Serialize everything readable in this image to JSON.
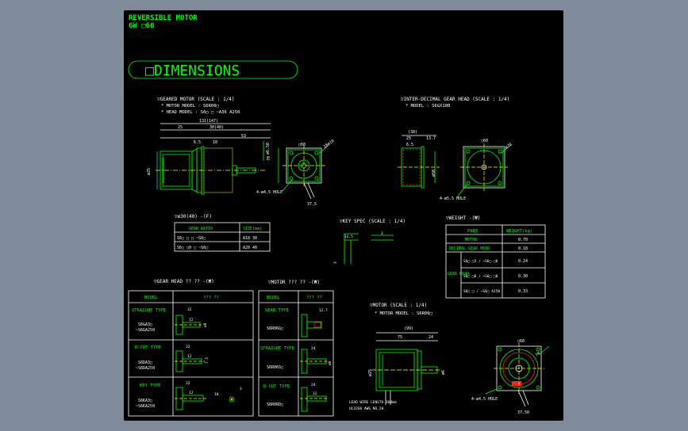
{
  "header": {
    "title": "REVERSIBLE MOTOR",
    "subtitle": "6W  □60"
  },
  "dimensions_title": "□DIMENSIONS",
  "geared_motor": {
    "title": "▽GEARED MOTOR (SCALE : 1/4)",
    "motor_model": "* MOTOR MODEL : S6R06□",
    "head_model": "* HEAD MODEL : S6□ □ ~A36   A250",
    "dims": [
      "131(147)",
      "25",
      "30(40)",
      "53",
      "6.5",
      "10",
      "□60",
      "70",
      "ø25",
      "4-ø4.5 HOLE",
      "28ø10",
      "ø6.50",
      "ø60",
      "37.5"
    ]
  },
  "inter_decimal": {
    "title": "▽INTER-DECIMAL GEAR HEAD (SCALE : 1/4)",
    "model": "* MODEL : S6GX10B",
    "dims": [
      "(38)",
      "25",
      "13.7",
      "□60",
      "6.5",
      "4-ø5.5 HOLE",
      "ø50",
      "ø70"
    ]
  },
  "gear_table": {
    "title": "▽ø30(40) -(₣)",
    "headers": [
      "GEAR RATIO",
      "SIZE(mm)"
    ],
    "rows": [
      [
        "S6□ □ □ ~S6□",
        "A18  30"
      ],
      [
        "S6□ □0 □ ~S6□",
        "A20  40"
      ]
    ]
  },
  "key_spec": {
    "title": "▽KEY SPEC (SCALE : 1/4)",
    "dims": [
      "12.5",
      "3",
      "3"
    ]
  },
  "weight": {
    "title": "▽WEIGHT -(₩)",
    "headers": [
      "PART",
      "WEIGHT(kg)"
    ],
    "rows": [
      {
        "part": "MOTOR",
        "weight": "0.70"
      },
      {
        "part": "DECIMAL GEAR HEAD",
        "weight": "0.18"
      },
      {
        "part": "S6□ □3 / ~S6□ □8",
        "weight": "0.24"
      },
      {
        "part": "S6□ □0 / ~S6□ □0",
        "weight": "0.30"
      },
      {
        "part": "S6□ □ / ~S6□ A250",
        "weight": "0.33"
      }
    ],
    "gear_head_label": "GEAR HEAD"
  },
  "gear_head_table": {
    "title": "▽GEAR HEAD ??  ??   -(₩)",
    "headers": [
      "MODEL",
      "???  ??"
    ],
    "rows": [
      {
        "type": "STRAIGHT TYPE",
        "models": [
          "S6GA3□",
          "~S6GA250"
        ],
        "dims": [
          "32",
          "12",
          "ø8"
        ]
      },
      {
        "type": "D-CUT TYPE",
        "models": [
          "S6DA3□",
          "~S6DA250"
        ],
        "dims": [
          "32",
          "12",
          "7.5"
        ]
      },
      {
        "type": "KEY TYPE",
        "models": [
          "S6KA3□",
          "~S6KA250"
        ],
        "dims": [
          "32",
          "12",
          "10",
          "3"
        ]
      }
    ]
  },
  "motor_table": {
    "title": "▽MOTOR ???  ??   -(₩)",
    "headers": [
      "MODEL",
      "???  ??"
    ],
    "rows": [
      {
        "type": "GEAR TYPE",
        "model": "S6R06G□",
        "dims": [
          "12.7"
        ]
      },
      {
        "type": "STRAIGHT TYPE",
        "model": "S6R06S□",
        "dims": [
          "24",
          "ø6"
        ]
      },
      {
        "type": "D-CUT TYPE",
        "model": "S6R06D□",
        "dims": [
          "24",
          "12"
        ]
      }
    ]
  },
  "motor": {
    "title": "▽MOTOR (SCALE : 1/4)",
    "model": "* MOTOR MODEL : S6R06□",
    "dims": [
      "(99)",
      "75",
      "24",
      "ø25",
      "ø6",
      "□60",
      "4-ø4.5 HOLE",
      "70",
      "37.50"
    ],
    "lead_wire": "LEAD WIRE LENGTH 300mm",
    "ul": "UL3266 AWG NO.20"
  }
}
